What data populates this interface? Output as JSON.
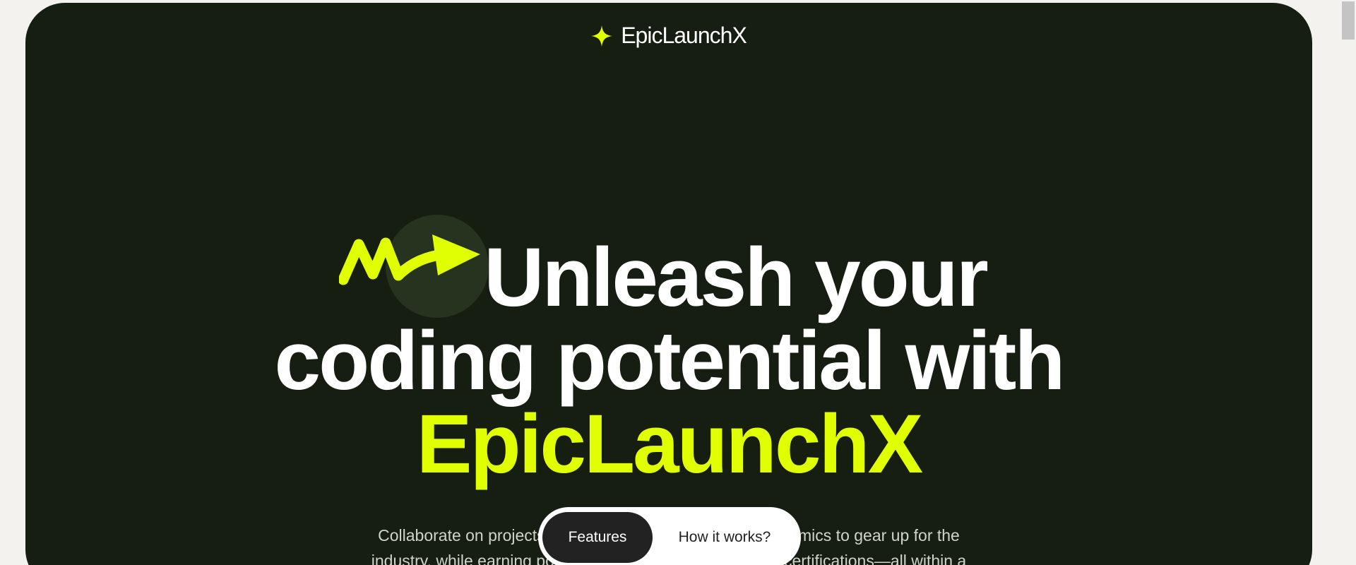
{
  "brand": {
    "name": "EpicLaunchX",
    "logo_icon": "sparkle-star-icon"
  },
  "hero": {
    "headline_line1": "Unleash your",
    "headline_line2": "coding potential with",
    "headline_accent": "EpicLaunchX",
    "decoration_icon": "zigzag-arrow-icon",
    "description_line1_left": "Collaborate on projects t",
    "description_line1_right": "namics to gear up for the",
    "description_line2_left": "industry, while earning poi",
    "description_line2_right": "certifications—all within a"
  },
  "tabs": [
    {
      "label": "Features",
      "active": true
    },
    {
      "label": "How it works?",
      "active": false
    }
  ],
  "colors": {
    "background": "#f3f2ef",
    "hero_bg": "#161e12",
    "accent": "#e0ff00",
    "text_light": "#ffffff",
    "tab_active_bg": "#222222"
  }
}
